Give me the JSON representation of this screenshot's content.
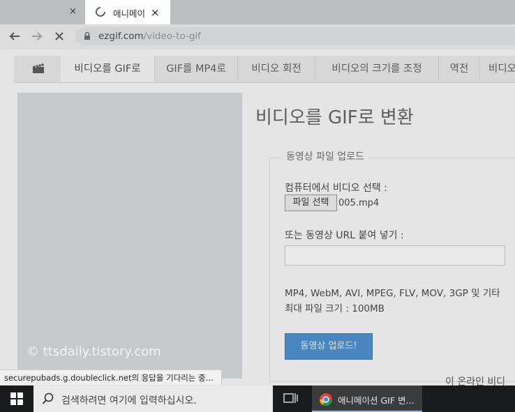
{
  "browser": {
    "tabs": [
      {
        "title": "",
        "close": "×"
      },
      {
        "title": "애니메이",
        "close": "×"
      }
    ],
    "url_domain": "ezgif.com",
    "url_path": "/video-to-gif",
    "status_text": "securepubads.g.doubleclick.net의 응답을 기다리는 중..."
  },
  "nav": {
    "items": [
      "비디오를 GIF로",
      "GIF를 MP4로",
      "비디오 회전",
      "비디오의 크기를 조정",
      "역전",
      "비디오"
    ]
  },
  "main": {
    "title": "비디오를 GIF로 변환",
    "legend": "동영상 파일 업로드",
    "choose_label": "컴퓨터에서 비디오 선택 :",
    "file_button": "파일 선택",
    "file_name": "005.mp4",
    "url_label": "또는 동영상 URL 붙여 넣기 :",
    "url_value": "",
    "formats": "MP4, WebM, AVI, MPEG, FLV, MOV, 3GP 및 기타",
    "max_size": "최대 파일 크기 : 100MB",
    "upload_button": "동영상 업로드!",
    "partial_bottom": "이 온라인 비디"
  },
  "watermark": "© ttsdaily.tistory.com",
  "taskbar": {
    "search_placeholder": "검색하려면 여기에 입력하십시오.",
    "chrome_label": "애니메이션 GIF 변..."
  },
  "colors": {
    "accent_button": "#4a86c0",
    "taskbar": "#181a1c"
  }
}
